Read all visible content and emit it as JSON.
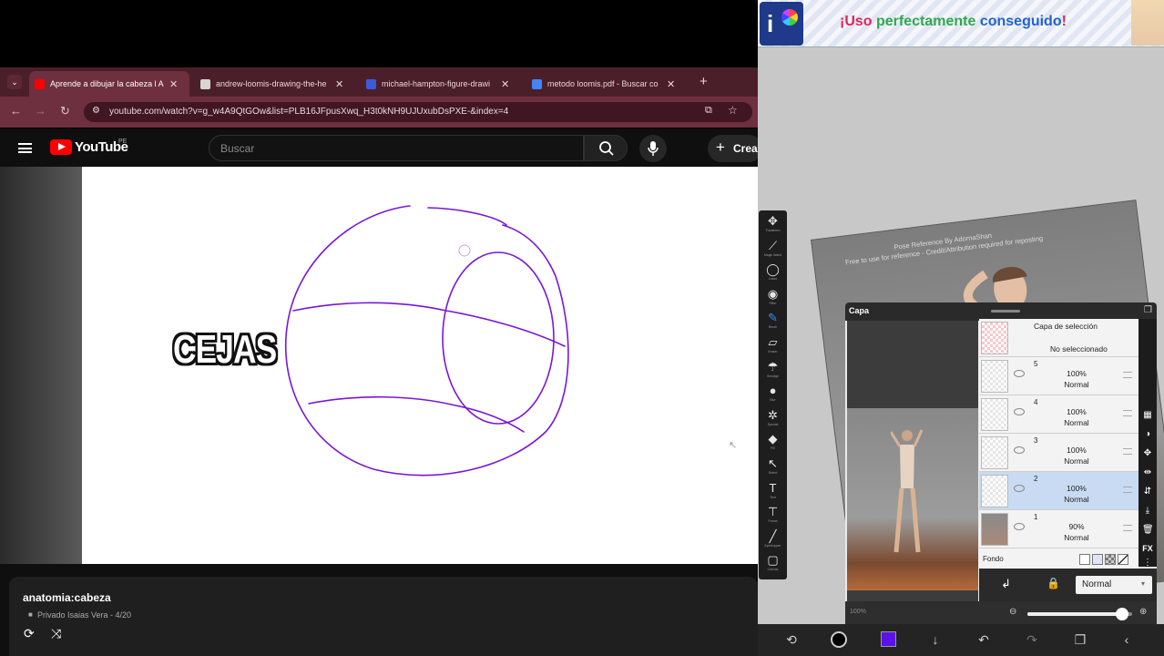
{
  "browser": {
    "tabs": [
      {
        "title": "Aprende a dibujar la cabeza l An",
        "favicon_color": "#ff0000",
        "active": true
      },
      {
        "title": "andrew-loomis-drawing-the-he",
        "favicon_color": "#d6d6d6",
        "active": false
      },
      {
        "title": "michael-hampton-figure-drawi",
        "favicon_color": "#3b5bdb",
        "active": false
      },
      {
        "title": "metodo loomis.pdf - Buscar co",
        "favicon_color": "#4285f4",
        "active": false
      }
    ],
    "new_tab_label": "+",
    "url": "youtube.com/watch?v=g_w4A9QtGOw&list=PLB16JFpusXwq_H3t0kNH9UJUxubDsPXE-&index=4"
  },
  "youtube": {
    "wordmark": "YouTube",
    "region": "PE",
    "search_placeholder": "Buscar",
    "create_label": "Crear",
    "video_overlay_text": "CEJAS",
    "playlist_title": "anatomia:cabeza",
    "playlist_meta": "Privado  Isaias Vera - 4/20"
  },
  "ibis": {
    "ad_text": {
      "part1": "¡Uso ",
      "part2": "perfectamente",
      "part3": " conseguido",
      "part4": "!"
    },
    "ad_colors": {
      "part1": "#e0245e",
      "part2": "#2fa84f",
      "part3": "#1e63d6",
      "part4": "#e0245e"
    },
    "photo_caption": "Pose Reference By AdornaShan\nFree to use for reference - Credit/Attribution required for reposting",
    "tools": [
      {
        "icon": "✥",
        "label": "Transform"
      },
      {
        "icon": "⟋",
        "label": "Magic Wand"
      },
      {
        "icon": "◯",
        "label": "Lasso"
      },
      {
        "icon": "◉",
        "label": "Filter"
      },
      {
        "icon": "✎",
        "label": "Brush"
      },
      {
        "icon": "▱",
        "label": "Eraser"
      },
      {
        "icon": "☂",
        "label": "Smudge"
      },
      {
        "icon": "●",
        "label": "Blur"
      },
      {
        "icon": "✲",
        "label": "Special"
      },
      {
        "icon": "◆",
        "label": "Fill"
      },
      {
        "icon": "↖",
        "label": "Select"
      },
      {
        "icon": "T",
        "label": "Text"
      },
      {
        "icon": "⊤",
        "label": "Frame"
      },
      {
        "icon": "╱",
        "label": "Eyedropper"
      },
      {
        "icon": "▢",
        "label": "Canvas"
      }
    ],
    "layer_panel": {
      "title": "Capa",
      "selection_layer": {
        "title": "Capa de selección",
        "status": "No seleccionado"
      },
      "layers": [
        {
          "num": "5",
          "opacity": "100%",
          "mode": "Normal",
          "selected": false
        },
        {
          "num": "4",
          "opacity": "100%",
          "mode": "Normal",
          "selected": false
        },
        {
          "num": "3",
          "opacity": "100%",
          "mode": "Normal",
          "selected": false
        },
        {
          "num": "2",
          "opacity": "100%",
          "mode": "Normal",
          "selected": true
        },
        {
          "num": "1",
          "opacity": "90%",
          "mode": "Normal",
          "selected": false
        }
      ],
      "background_label": "Fondo",
      "blend_mode": "Normal",
      "opacity_label": "100%",
      "opacity_value": 0.9
    },
    "brush_color": "#5b12e8"
  }
}
